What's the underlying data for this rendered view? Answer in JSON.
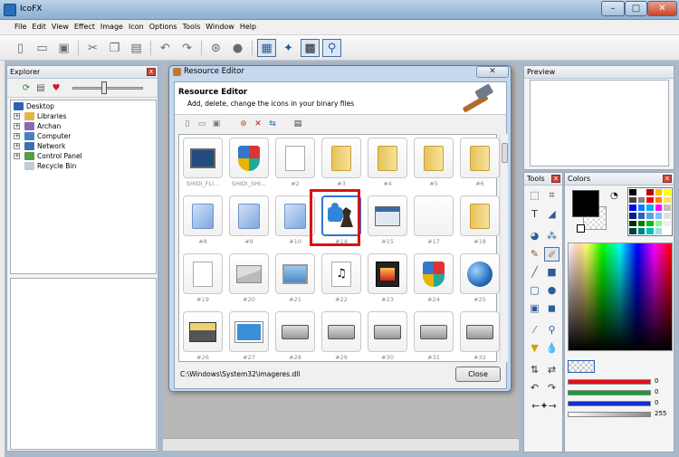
{
  "window": {
    "title": "IcoFX",
    "min": "–",
    "max": "□",
    "close": "✕"
  },
  "menu": [
    "File",
    "Edit",
    "View",
    "Effect",
    "Image",
    "Icon",
    "Options",
    "Tools",
    "Window",
    "Help"
  ],
  "toolbar": [
    "new-icon",
    "open-icon",
    "save-icon",
    "cut-icon",
    "copy-icon",
    "paste-icon",
    "undo-icon",
    "redo-icon",
    "web-icon",
    "apple-icon",
    "image-icon",
    "wand-icon",
    "select-icon",
    "zoom-icon"
  ],
  "explorer": {
    "title": "Explorer",
    "tree": [
      {
        "label": "Desktop",
        "expand": ""
      },
      {
        "label": "Libraries",
        "expand": "+"
      },
      {
        "label": "Archan",
        "expand": "+"
      },
      {
        "label": "Computer",
        "expand": "+"
      },
      {
        "label": "Network",
        "expand": "+"
      },
      {
        "label": "Control Panel",
        "expand": "+"
      },
      {
        "label": "Recycle Bin",
        "expand": ""
      }
    ]
  },
  "preview": {
    "title": "Preview"
  },
  "tools": {
    "title": "Tools"
  },
  "colors": {
    "title": "Colors",
    "palette": [
      "#000000",
      "#ffffff",
      "#c00000",
      "#ffc000",
      "#ffff00",
      "#404040",
      "#808080",
      "#ff0000",
      "#ff8000",
      "#ffe060",
      "#0000ff",
      "#0080ff",
      "#00b0f0",
      "#ff00ff",
      "#c0c0c0",
      "#002080",
      "#3060c0",
      "#60a0e0",
      "#80c0ff",
      "#e0e0e0",
      "#003000",
      "#008000",
      "#00c000",
      "#80ff80",
      "#f0f0f0",
      "#004040",
      "#008080",
      "#00c0c0",
      "#a0e0e0",
      "#ffffff"
    ],
    "channels": [
      {
        "name": "red",
        "value": "0",
        "color": "#e0101a"
      },
      {
        "name": "green",
        "value": "0",
        "color": "#10a030"
      },
      {
        "name": "blue",
        "value": "0",
        "color": "#1030d0"
      },
      {
        "name": "alpha",
        "value": "255",
        "color": "#a0a0a0"
      }
    ]
  },
  "dialog": {
    "title": "Resource Editor",
    "close": "✕",
    "heading": "Resource Editor",
    "subheading": "Add, delete, change the icons in your binary files",
    "path": "C:\\Windows\\System32\\imageres.dll",
    "close_button": "Close",
    "icons": [
      {
        "label": "SHIDI_FLI...",
        "icon": "monitor"
      },
      {
        "label": "SHIDI_SHI...",
        "icon": "shield"
      },
      {
        "label": "#2",
        "icon": "page"
      },
      {
        "label": "#3",
        "icon": "folder"
      },
      {
        "label": "#4",
        "icon": "folder"
      },
      {
        "label": "#5",
        "icon": "folder"
      },
      {
        "label": "#6",
        "icon": "folder"
      },
      {
        "label": "#8",
        "icon": "blue"
      },
      {
        "label": "#9",
        "icon": "blue"
      },
      {
        "label": "#10",
        "icon": "blue"
      },
      {
        "label": "#14",
        "icon": "puzzle",
        "selected": true
      },
      {
        "label": "#15",
        "icon": "window"
      },
      {
        "label": "#17",
        "icon": "empty"
      },
      {
        "label": "#18",
        "icon": "folder"
      },
      {
        "label": "#19",
        "icon": "page"
      },
      {
        "label": "#20",
        "icon": "mail"
      },
      {
        "label": "#21",
        "icon": "picture"
      },
      {
        "label": "#22",
        "icon": "music"
      },
      {
        "label": "#23",
        "icon": "film"
      },
      {
        "label": "#24",
        "icon": "shield"
      },
      {
        "label": "#25",
        "icon": "globe"
      },
      {
        "label": "#26",
        "icon": "printer"
      },
      {
        "label": "#27",
        "icon": "contact"
      },
      {
        "label": "#28",
        "icon": "drive"
      },
      {
        "label": "#29",
        "icon": "drive"
      },
      {
        "label": "#30",
        "icon": "drive"
      },
      {
        "label": "#31",
        "icon": "drive"
      },
      {
        "label": "#32",
        "icon": "drive"
      }
    ]
  }
}
